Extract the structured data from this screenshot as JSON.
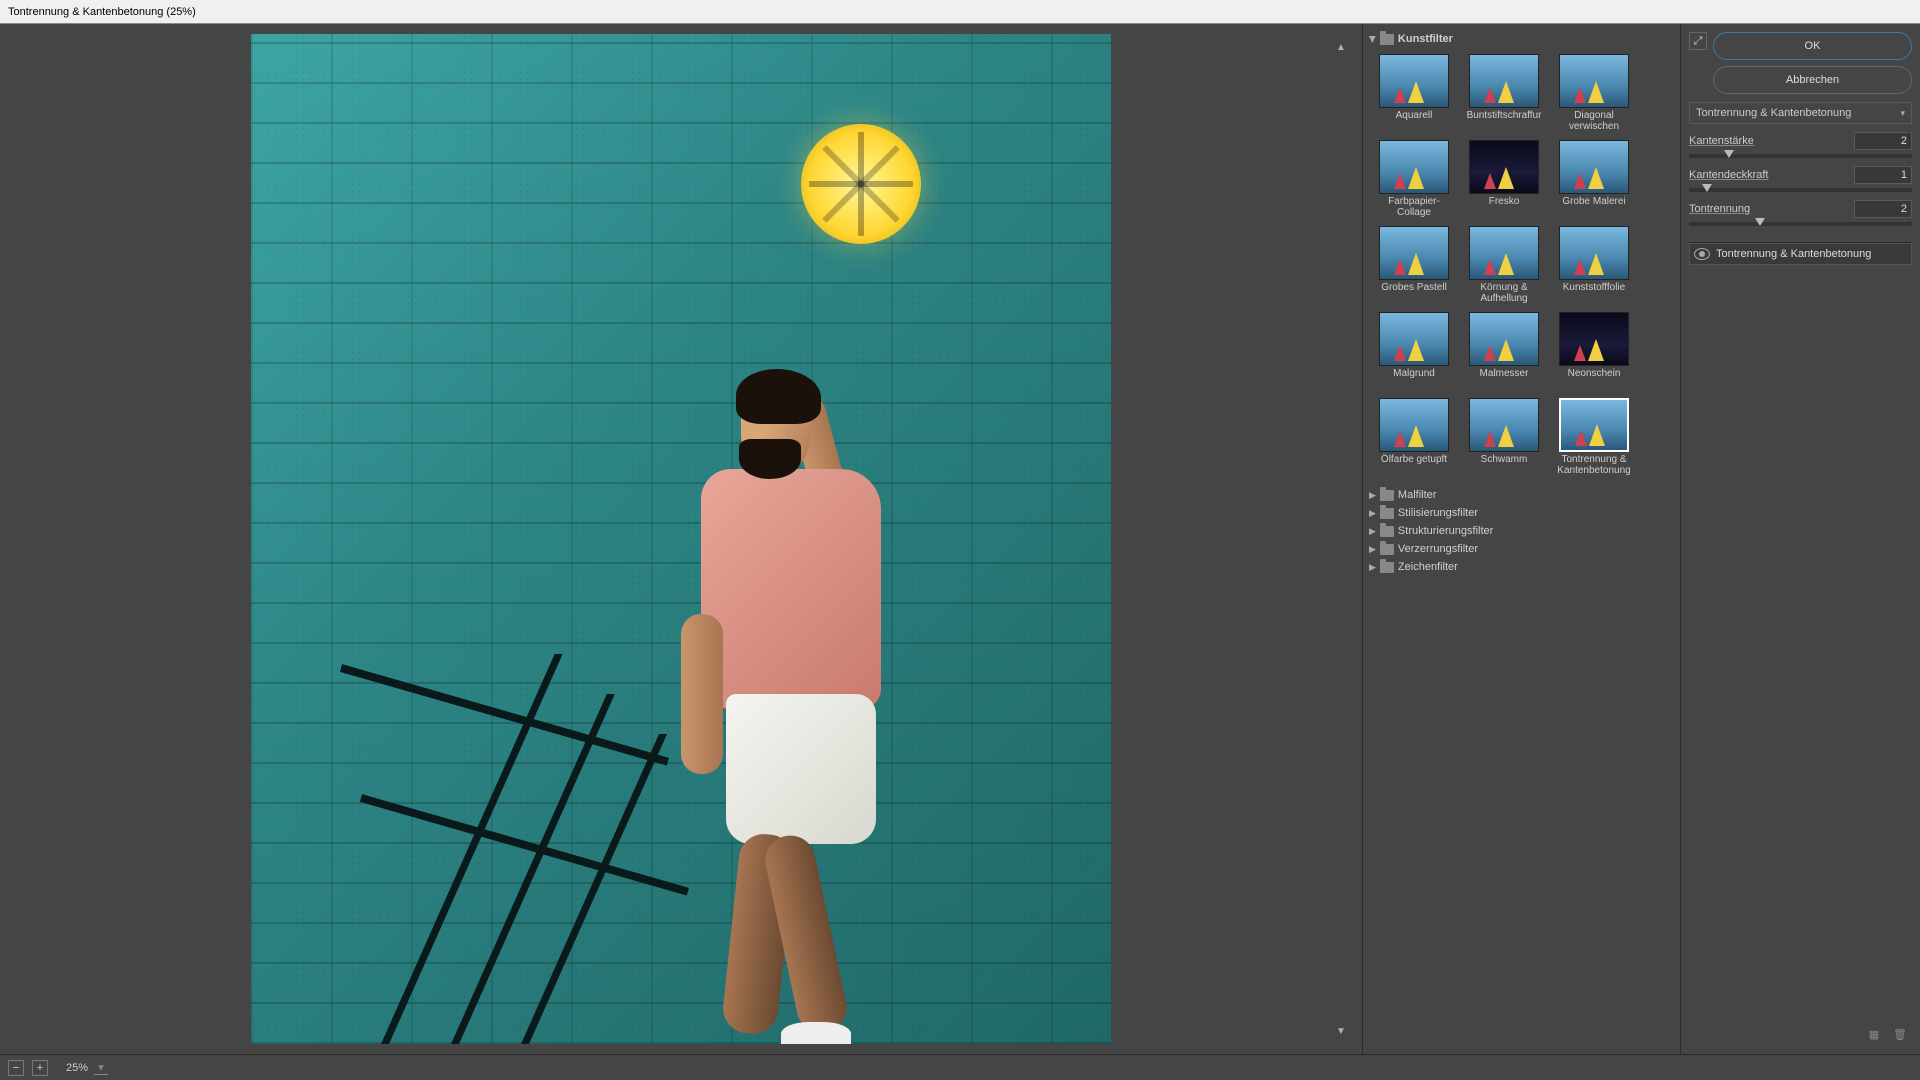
{
  "window": {
    "title": "Tontrennung & Kantenbetonung (25%)"
  },
  "zoom": {
    "value": "25%"
  },
  "buttons": {
    "ok": "OK",
    "cancel": "Abbrechen"
  },
  "filter_dropdown": {
    "selected": "Tontrennung & Kantenbetonung"
  },
  "params": {
    "kantenstaerke": {
      "label": "Kantenstärke",
      "value": "2",
      "pos": 18
    },
    "kantendeckkraft": {
      "label": "Kantendeckkraft",
      "value": "1",
      "pos": 8
    },
    "tontrennung": {
      "label": "Tontrennung",
      "value": "2",
      "pos": 32
    }
  },
  "layers": {
    "active": "Tontrennung & Kantenbetonung"
  },
  "categories": {
    "open": "Kunstfilter",
    "closed": [
      "Malfilter",
      "Stilisierungsfilter",
      "Strukturierungsfilter",
      "Verzerrungsfilter",
      "Zeichenfilter"
    ]
  },
  "thumbnails": [
    {
      "label": "Aquarell",
      "dark": false
    },
    {
      "label": "Buntstiftschraffur",
      "dark": false
    },
    {
      "label": "Diagonal verwischen",
      "dark": false
    },
    {
      "label": "Farbpapier-Collage",
      "dark": false
    },
    {
      "label": "Fresko",
      "dark": true
    },
    {
      "label": "Grobe Malerei",
      "dark": false
    },
    {
      "label": "Grobes Pastell",
      "dark": false
    },
    {
      "label": "Körnung & Aufhellung",
      "dark": false
    },
    {
      "label": "Kunststofffolie",
      "dark": false
    },
    {
      "label": "Malgrund",
      "dark": false
    },
    {
      "label": "Malmesser",
      "dark": false
    },
    {
      "label": "Neonschein",
      "dark": true
    },
    {
      "label": "Ölfarbe getupft",
      "dark": false
    },
    {
      "label": "Schwamm",
      "dark": false
    },
    {
      "label": "Tontrennung & Kantenbetonung",
      "dark": false,
      "selected": true
    }
  ]
}
